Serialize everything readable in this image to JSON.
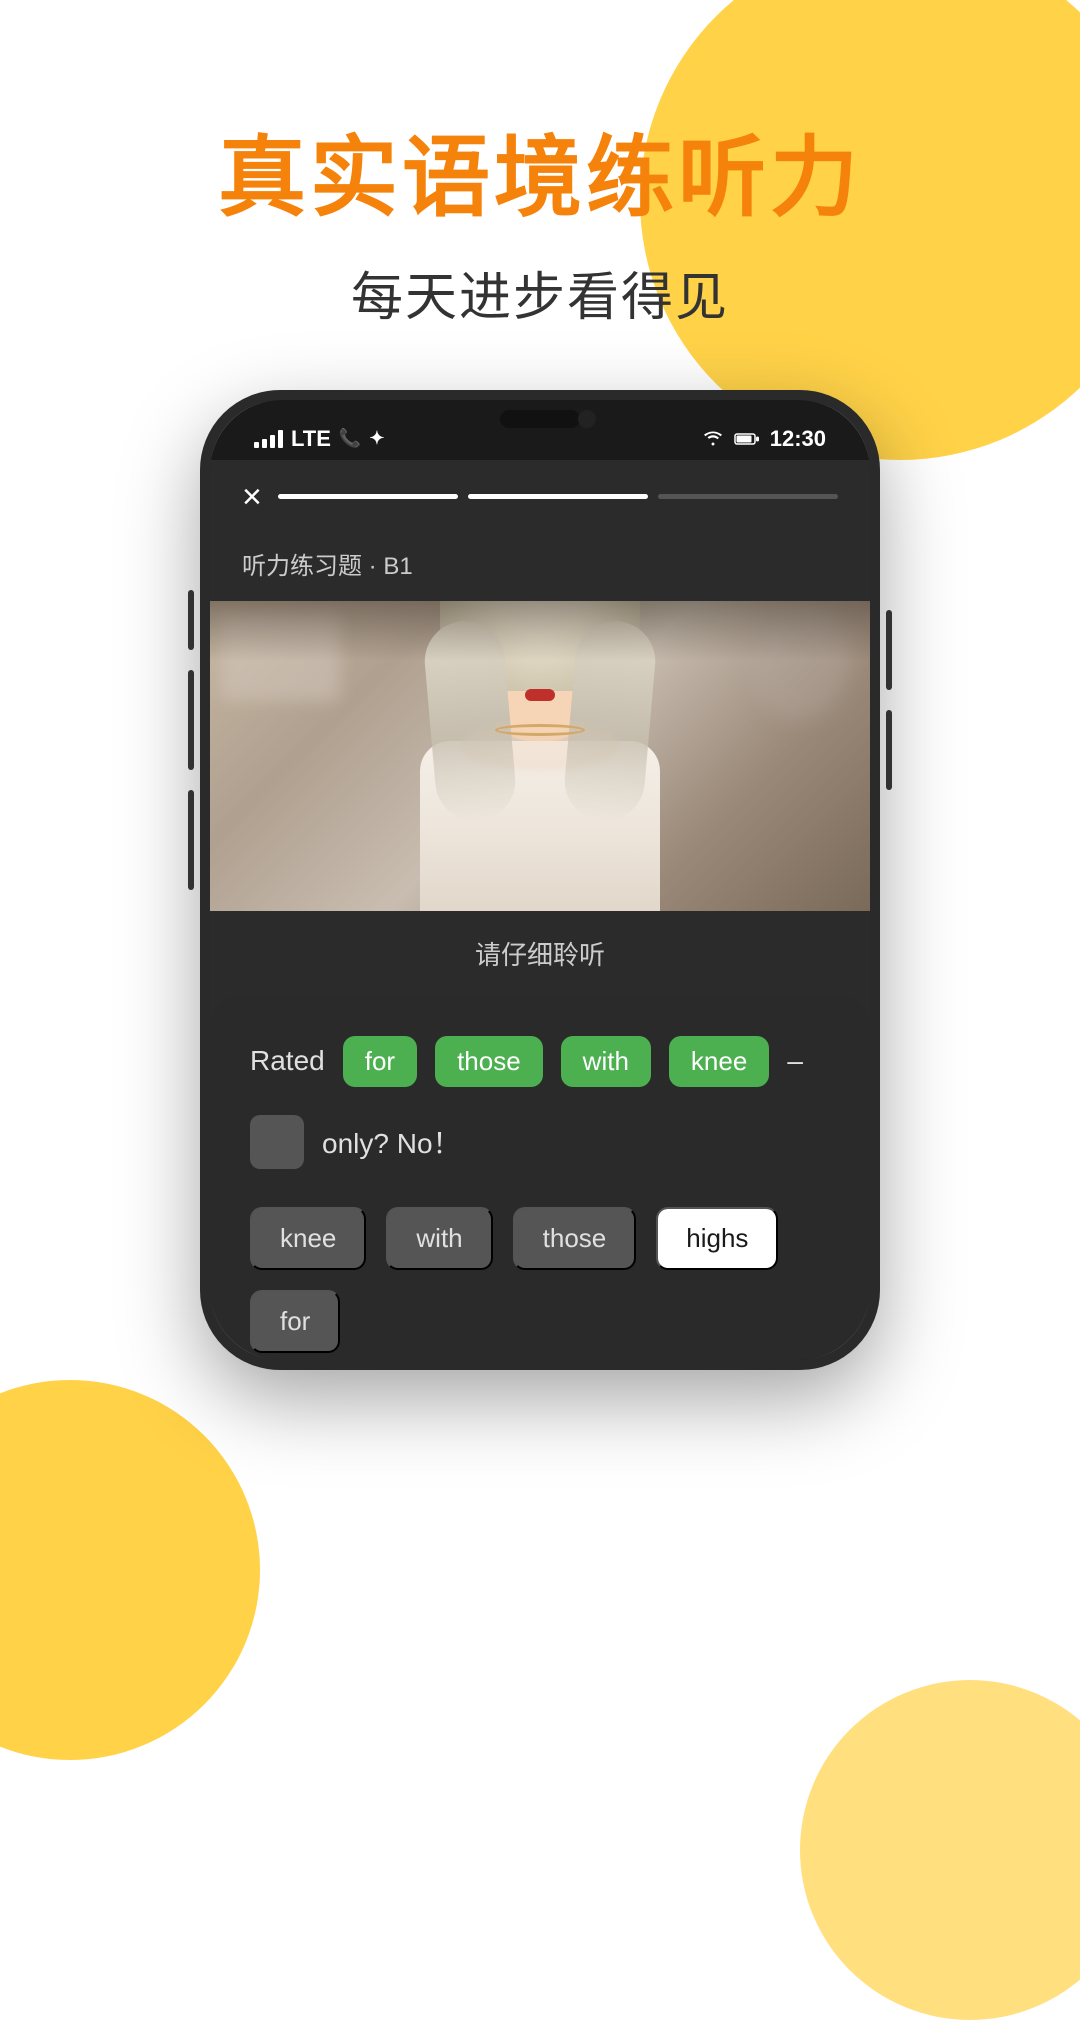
{
  "page": {
    "background_color": "#ffffff"
  },
  "header": {
    "title_main": "真实语境练听力",
    "title_sub": "每天进步看得见",
    "title_color": "#F5820A",
    "sub_color": "#333333"
  },
  "phone": {
    "status_bar": {
      "signal": "signal",
      "network": "LTE",
      "call_icon": "☎",
      "bluetooth": "✦",
      "wifi": "wifi",
      "battery": "battery",
      "time": "12:30"
    },
    "close_button": "×",
    "progress": {
      "segments": [
        {
          "state": "active"
        },
        {
          "state": "active"
        },
        {
          "state": "inactive"
        }
      ]
    },
    "exercise_label": "听力练习题 · B1",
    "listen_text": "请仔细聆听",
    "answer_panel": {
      "row1_label": "Rated",
      "row1_words": [
        "for",
        "those",
        "with",
        "knee"
      ],
      "row1_dash": "–",
      "row2_blank": "",
      "row2_text": "only?  No！",
      "choices": [
        {
          "word": "knee",
          "selected": false
        },
        {
          "word": "with",
          "selected": false
        },
        {
          "word": "those",
          "selected": false
        },
        {
          "word": "highs",
          "selected": true
        },
        {
          "word": "for",
          "selected": false
        }
      ]
    }
  }
}
